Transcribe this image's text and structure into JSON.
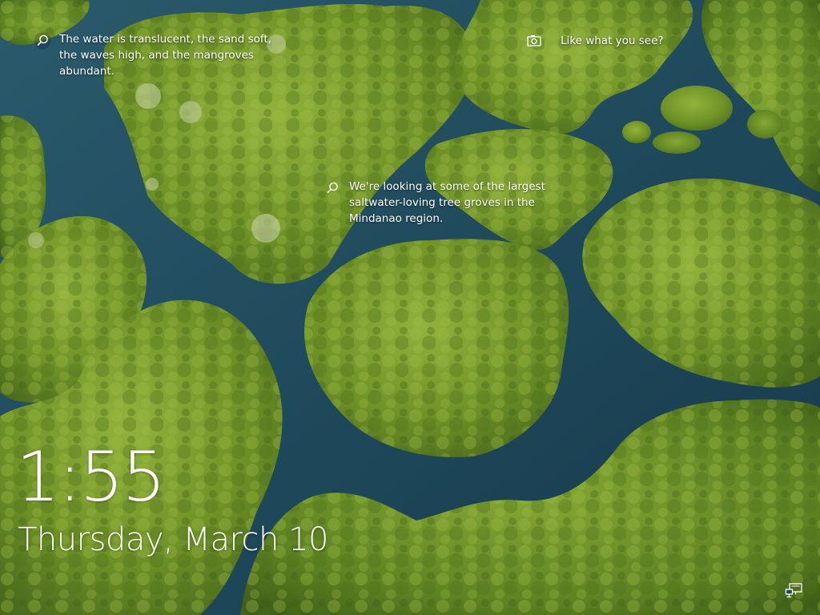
{
  "lockscreen": {
    "spotlight_top_left": {
      "icon": "search-icon",
      "text": "The water is translucent, the sand soft, the waves high, and the mangroves abundant."
    },
    "spotlight_center": {
      "icon": "search-icon",
      "text": "We're looking at some of the largest saltwater-loving tree groves in the Mindanao region."
    },
    "spotlight_top_right": {
      "icon": "camera-icon",
      "text": "Like what you see?"
    },
    "clock": {
      "time": "1:55",
      "date": "Thursday, March 10"
    },
    "status": {
      "network_icon": "network-icon"
    }
  },
  "colors": {
    "water": "#1f4a5c",
    "water_deep": "#163d4e",
    "foliage": "#6b8e23",
    "foliage_light": "#8fae3a",
    "foliage_dark": "#3f5e18",
    "text": "#ffffff"
  }
}
